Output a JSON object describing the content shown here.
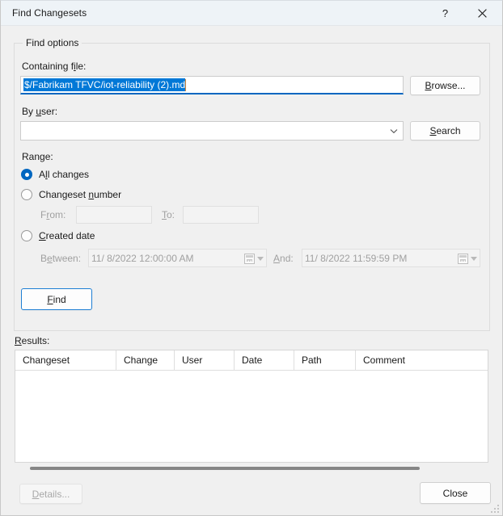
{
  "window": {
    "title": "Find Changesets",
    "help_icon": "question-mark-icon",
    "close_icon": "close-x-icon"
  },
  "find_options": {
    "legend": "Find options",
    "containing_file": {
      "label": "Containing file:",
      "value": "$/Fabrikam TFVC/iot-reliability (2).md",
      "selected": true,
      "browse_label": "Browse..."
    },
    "by_user": {
      "label": "By user:",
      "value": "",
      "placeholder": "",
      "search_label": "Search",
      "arrow_icon": "chevron-down-icon"
    },
    "range": {
      "label": "Range:",
      "options": [
        {
          "label": "All changes",
          "selected": true
        },
        {
          "label": "Changeset number",
          "selected": false
        },
        {
          "label": "Created date",
          "selected": false
        }
      ],
      "changeset_number": {
        "from_label": "From:",
        "from_value": "",
        "to_label": "To:",
        "to_value": "",
        "enabled": false
      },
      "created_date": {
        "between_label": "Between:",
        "between_value": "11/  8/2022 12:00:00 AM",
        "and_label": "And:",
        "and_value": "11/  8/2022 11:59:59 PM",
        "calendar_icon": "calendar-icon",
        "enabled": false
      }
    },
    "find_label": "Find"
  },
  "results": {
    "label": "Results:",
    "columns": [
      {
        "label": "Changeset",
        "width": 125
      },
      {
        "label": "Change",
        "width": 72
      },
      {
        "label": "Date",
        "width": 0
      }
    ],
    "headers": [
      "Changeset",
      "Change",
      "User",
      "Date",
      "Path",
      "Comment"
    ],
    "rows": [],
    "scrollbar": "horizontal-scrollbar"
  },
  "footer": {
    "details_label": "Details...",
    "details_enabled": false,
    "close_label": "Close"
  },
  "colors": {
    "accent": "#0067c0",
    "selection": "#0078d7",
    "titlebar": "#eef3f7",
    "window_bg": "#f0f0f0",
    "caret": "#d98a3c"
  }
}
